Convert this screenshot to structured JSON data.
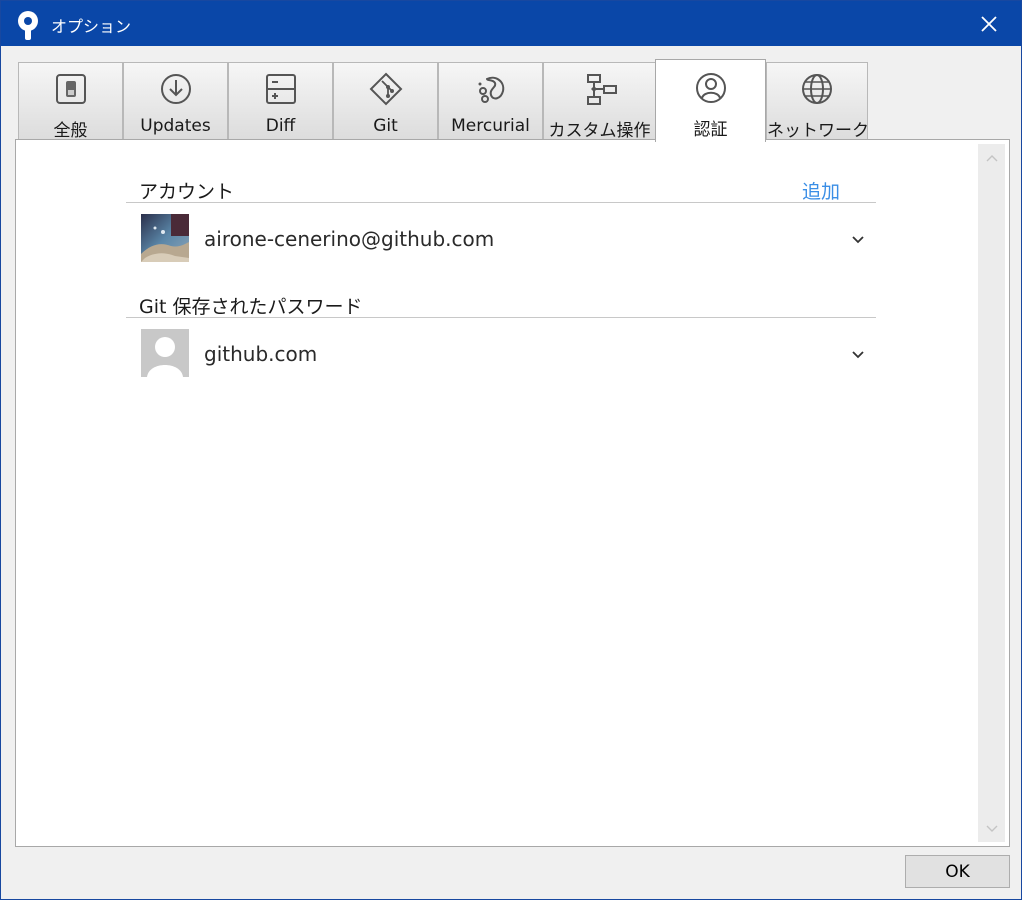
{
  "window": {
    "title": "オプション",
    "close_icon": "close-icon"
  },
  "tabs": [
    {
      "label": "全般",
      "icon": "toggle-switch-icon"
    },
    {
      "label": "Updates",
      "icon": "download-circle-icon"
    },
    {
      "label": "Diff",
      "icon": "diff-icon"
    },
    {
      "label": "Git",
      "icon": "git-icon"
    },
    {
      "label": "Mercurial",
      "icon": "mercurial-icon"
    },
    {
      "label": "カスタム操作",
      "icon": "flowchart-icon"
    },
    {
      "label": "認証",
      "icon": "user-circle-icon",
      "active": true
    },
    {
      "label": "ネットワーク",
      "icon": "globe-icon"
    }
  ],
  "auth": {
    "accounts_title": "アカウント",
    "add_label": "追加",
    "accounts": [
      {
        "label": "airone-cenerino@github.com",
        "avatar": "user-photo"
      }
    ],
    "passwords_title": "Git 保存されたパスワード",
    "passwords": [
      {
        "label": "github.com",
        "avatar": "default-user-avatar"
      }
    ]
  },
  "footer": {
    "ok_label": "OK"
  },
  "colors": {
    "titlebar": "#0a47a8",
    "link": "#3a8ee6"
  }
}
